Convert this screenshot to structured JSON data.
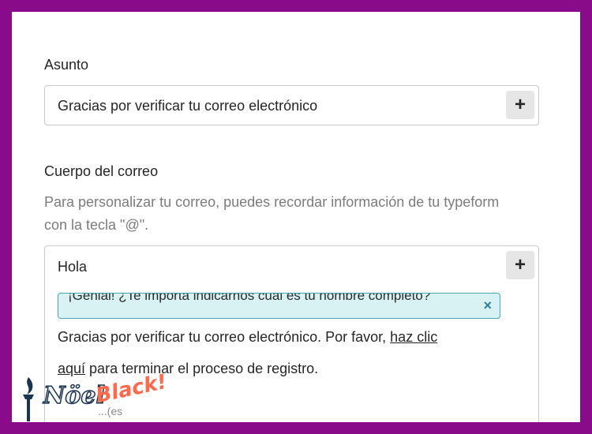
{
  "subject": {
    "label": "Asunto",
    "value": "Gracias por verificar tu correo electrónico",
    "add_label": "+"
  },
  "body": {
    "label": "Cuerpo del correo",
    "help": "Para personalizar tu correo, puedes recordar información de tu typeform con la tecla \"@\".",
    "greeting": "Hola",
    "add_label": "+",
    "tag_text": "¡Genial! ¿Te importa indicarnos cuál es tu nombre completo?",
    "tag_remove": "×",
    "line1_prefix": "Gracias por verificar tu correo electrónico. Por favor, ",
    "link_part1": "haz clic ",
    "link_part2": "aquí",
    "line2_suffix": " para terminar el proceso de registro.",
    "partial_line": "...(es"
  },
  "logo": {
    "word1": "Nöel",
    "word2": "Black!"
  },
  "colors": {
    "frame": "#8a0b8a",
    "tag_bg": "#d8f2f4",
    "tag_border": "#46a7b5"
  }
}
